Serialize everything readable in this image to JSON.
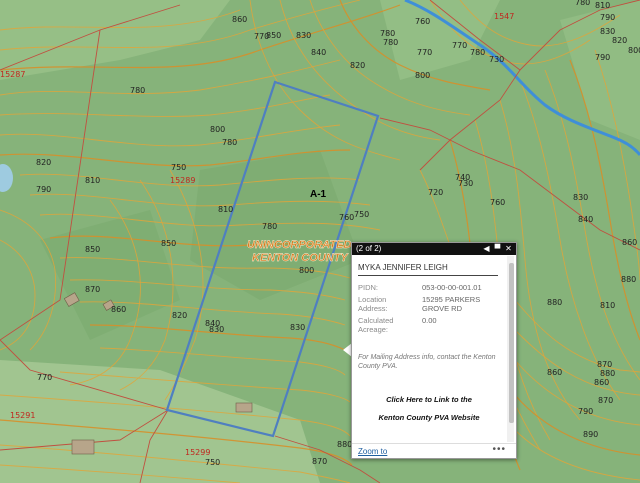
{
  "map": {
    "zone_label": "A-1",
    "county_label_line1": "UNINCORPORATED",
    "county_label_line2": "KENTON COUNTY",
    "parcel_numbers": [
      "15287",
      "15289",
      "15291",
      "15299",
      "1547"
    ],
    "elevation_labels": [
      "860",
      "850",
      "830",
      "840",
      "820",
      "800",
      "780",
      "770",
      "730",
      "720",
      "740",
      "750",
      "790",
      "810",
      "820",
      "850",
      "870",
      "860",
      "840",
      "820",
      "830",
      "850",
      "810",
      "830",
      "800",
      "780",
      "770",
      "760",
      "750",
      "730",
      "780",
      "760",
      "770",
      "780",
      "790",
      "780",
      "810",
      "800",
      "780",
      "830",
      "760",
      "830",
      "840",
      "880",
      "810",
      "860",
      "870",
      "870",
      "880",
      "890",
      "880",
      "860",
      "860",
      "790",
      "820",
      "800",
      "790",
      "780",
      "770",
      "750",
      "880",
      "870"
    ],
    "colors": {
      "terrain": "#86b37a",
      "contour": "#e0a53a",
      "selected_parcel": "#4f7fc0",
      "parcel_line": "#c05040",
      "river": "#3f8fd8"
    }
  },
  "popup": {
    "count": "(2 of 2)",
    "title": "MYKA JENNIFER LEIGH",
    "rows": [
      {
        "label": "PIDN:",
        "value": "053-00-00-001.01"
      },
      {
        "label": "Location Address:",
        "value": "15295 PARKERS GROVE RD"
      },
      {
        "label": "Calculated Acreage:",
        "value": "0.00"
      }
    ],
    "note": "For Mailing Address info, contact the Kenton County PVA.",
    "link_line1": "Click Here to Link to the",
    "link_line2": "Kenton County PVA Website",
    "zoom_label": "Zoom to",
    "more_label": "•••",
    "buttons": {
      "prev": "◀",
      "maximize": "▀",
      "close": "✕"
    }
  }
}
